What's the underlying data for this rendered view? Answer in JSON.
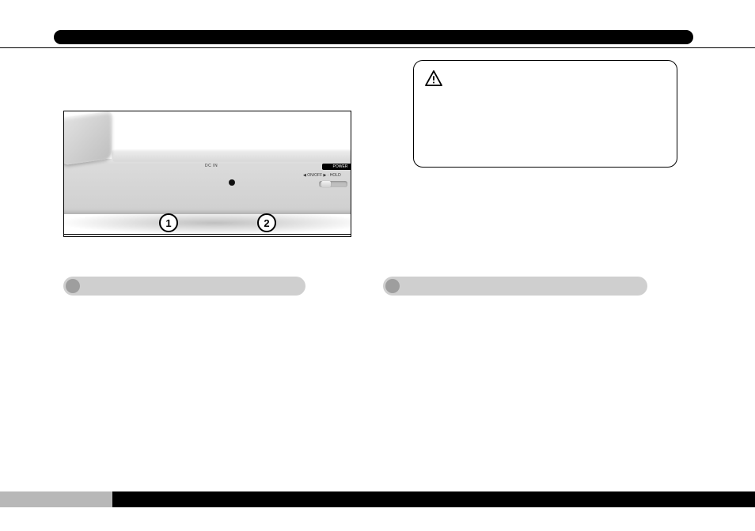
{
  "diagram": {
    "dcin_label": "DC IN",
    "power_badge": "POWER",
    "onoff_label": "◀ ON/OFF ▶ · HOLD",
    "callout_1": "1",
    "callout_2": "2"
  }
}
